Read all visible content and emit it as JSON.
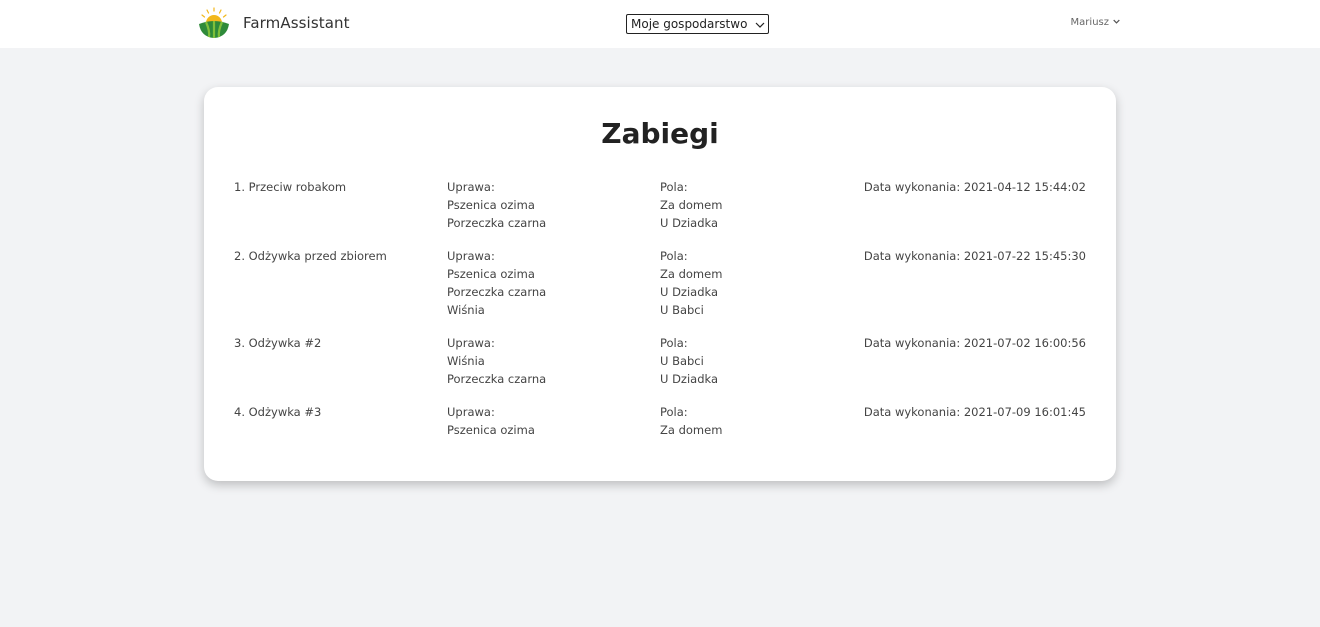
{
  "brand": {
    "name": "FarmAssistant",
    "colors": {
      "sun": "#f2b81c",
      "field_light": "#7fbf3a",
      "field_dark": "#2f8a3a"
    }
  },
  "header": {
    "farm_select": {
      "selected": "Moje gospodarstwo"
    },
    "user": {
      "name": "Mariusz"
    }
  },
  "page": {
    "title": "Zabiegi",
    "treatments": [
      {
        "name": "1. Przeciw robakom",
        "crops_label": "Uprawa:",
        "crops": [
          "Pszenica ozima",
          "Porzeczka czarna"
        ],
        "fields_label": "Pola:",
        "fields": [
          "Za domem",
          "U Dziadka"
        ],
        "date": "Data wykonania: 2021-04-12 15:44:02"
      },
      {
        "name": "2. Odżywka przed zbiorem",
        "crops_label": "Uprawa:",
        "crops": [
          "Pszenica ozima",
          "Porzeczka czarna",
          "Wiśnia"
        ],
        "fields_label": "Pola:",
        "fields": [
          "Za domem",
          "U Dziadka",
          "U Babci"
        ],
        "date": "Data wykonania: 2021-07-22 15:45:30"
      },
      {
        "name": "3. Odżywka #2",
        "crops_label": "Uprawa:",
        "crops": [
          "Wiśnia",
          "Porzeczka czarna"
        ],
        "fields_label": "Pola:",
        "fields": [
          "U Babci",
          "U Dziadka"
        ],
        "date": "Data wykonania: 2021-07-02 16:00:56"
      },
      {
        "name": "4. Odżywka #3",
        "crops_label": "Uprawa:",
        "crops": [
          "Pszenica ozima"
        ],
        "fields_label": "Pola:",
        "fields": [
          "Za domem"
        ],
        "date": "Data wykonania: 2021-07-09 16:01:45"
      }
    ]
  }
}
